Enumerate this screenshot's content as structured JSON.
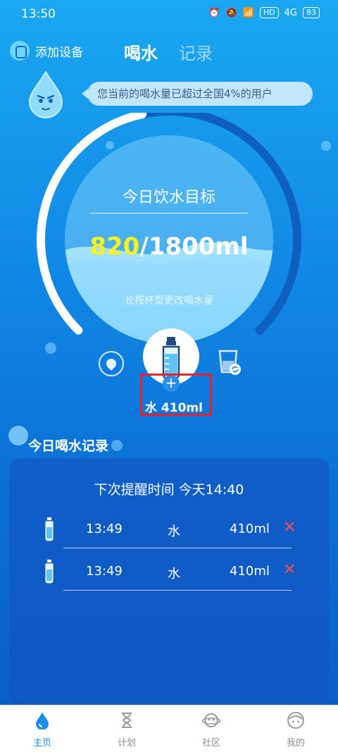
{
  "status_bar": {
    "time": "13:50",
    "network": "4G",
    "hd": "HD",
    "battery": "83"
  },
  "header": {
    "add_device": "添加设备",
    "tab_active": "喝水",
    "tab_inactive": "记录"
  },
  "bubble_text": "您当前的喝水量已超过全国4%的用户",
  "goal": {
    "title": "今日饮水目标",
    "current": "820",
    "target": "/1800ml",
    "progress": 0.4556,
    "hint": "长按杯型更改喝水量"
  },
  "drink": {
    "label": "水 410ml",
    "plus": "+"
  },
  "records": {
    "title": "今日喝水记录",
    "reminder": "下次提醒时间 今天14:40",
    "rows": [
      {
        "time": "13:49",
        "kind": "水",
        "amount": "410ml",
        "delete": "✕"
      },
      {
        "time": "13:49",
        "kind": "水",
        "amount": "410ml",
        "delete": "✕"
      }
    ]
  },
  "nav": [
    {
      "label": "主页",
      "icon": "drop-icon",
      "active": true
    },
    {
      "label": "计划",
      "icon": "hourglass-icon",
      "active": false
    },
    {
      "label": "社区",
      "icon": "planet-icon",
      "active": false
    },
    {
      "label": "我的",
      "icon": "face-icon",
      "active": false
    }
  ],
  "colors": {
    "accent_yellow": "#fff21a",
    "nav_active": "#1b8ef0",
    "delete_red": "#ff4a4a",
    "highlight": "#e8212b"
  }
}
